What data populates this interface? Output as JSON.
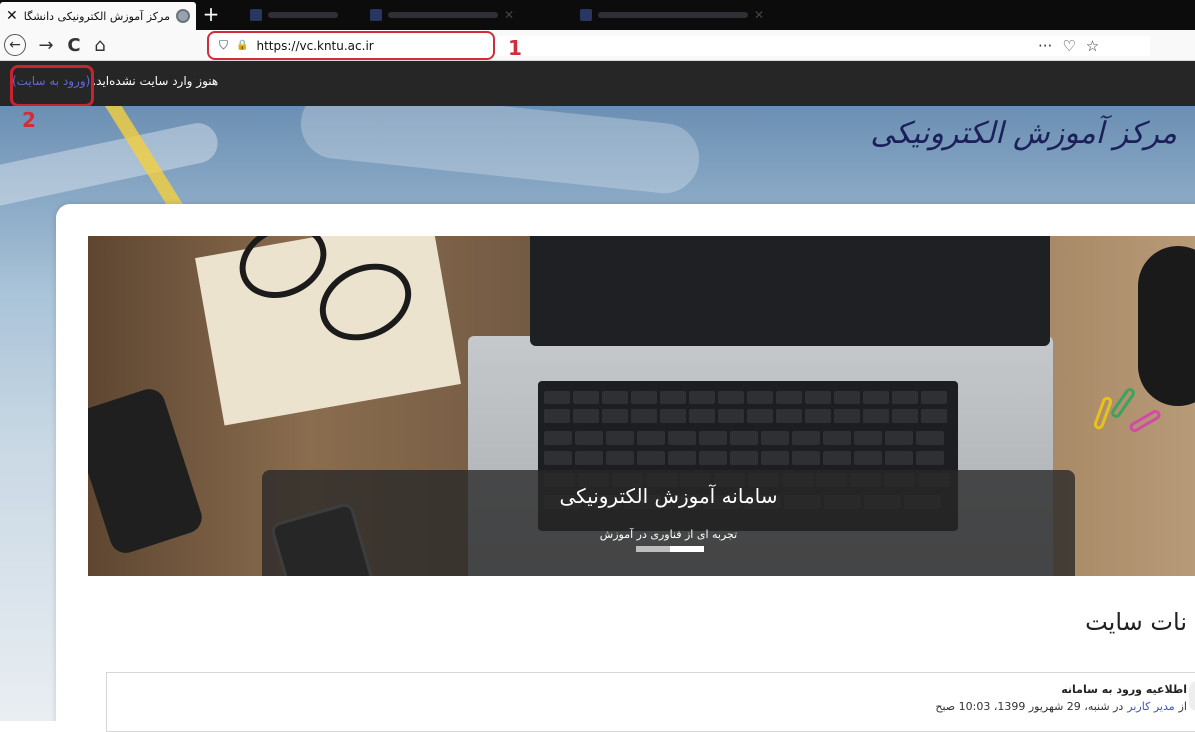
{
  "browser": {
    "tab_title": "مرکز آموزش الکترونیکی دانشگاه خو",
    "tab_close": "✕",
    "newtab_symbol": "+",
    "url": "https://vc.kntu.ac.ir",
    "back_icon": "←",
    "forward_icon": "→",
    "reload_icon": "C",
    "home_icon": "⌂",
    "shield_icon": "⛉",
    "lock_icon": "🔒",
    "more_icon": "···",
    "pocket_icon": "♡",
    "star_icon": "☆"
  },
  "annotations": {
    "one": "1",
    "two": "2"
  },
  "site": {
    "login_status_text": "هنوز وارد سایت نشده‌اید.",
    "login_link": "(ورود به سایت)",
    "logo_text": "مرکز آموزش الکترونیکی",
    "hero_title": "سامانه آموزش الکترونیکی",
    "hero_subtitle": "تجربه ای از فناوری در آموزش",
    "section_title": "نات سایت",
    "news": {
      "title": "اطلاعیه ورود به سامانه",
      "meta_prefix": "از",
      "author": "مدیر کاربر",
      "meta_suffix": "در شنبه، 29 شهریور 1399، 10:03 صبح"
    }
  },
  "colors": {
    "annotation_red": "#d32b3a",
    "site_bar": "#262626",
    "link_blue": "#5e6bd6"
  }
}
